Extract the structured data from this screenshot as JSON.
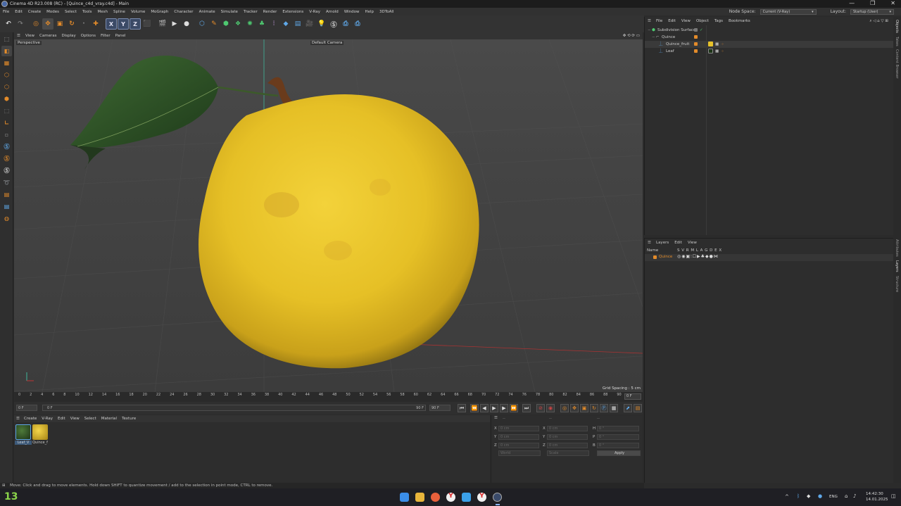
{
  "window": {
    "title": "Cinema 4D R23.008 (RC) - [Quince_c4d_vray.c4d] - Main",
    "controls": [
      "—",
      "❐",
      "✕"
    ]
  },
  "menu": {
    "items": [
      "File",
      "Edit",
      "Create",
      "Modes",
      "Select",
      "Tools",
      "Mesh",
      "Spline",
      "Volume",
      "MoGraph",
      "Character",
      "Animate",
      "Simulate",
      "Tracker",
      "Render",
      "Extensions",
      "V-Ray",
      "Arnold",
      "Window",
      "Help",
      "3DToAll"
    ],
    "node_space_label": "Node Space:",
    "node_space_value": "Current (V-Ray)",
    "layout_label": "Layout:",
    "layout_value": "Startup (User)"
  },
  "viewport": {
    "menu": [
      "View",
      "Cameras",
      "Display",
      "Options",
      "Filter",
      "Panel"
    ],
    "label": "Perspective",
    "camera": "Default Camera",
    "grid_spacing": "Grid Spacing : 5 cm"
  },
  "timeline": {
    "ticks": [
      "0",
      "2",
      "4",
      "6",
      "8",
      "10",
      "12",
      "14",
      "16",
      "18",
      "20",
      "22",
      "24",
      "26",
      "28",
      "30",
      "32",
      "34",
      "36",
      "38",
      "40",
      "42",
      "44",
      "46",
      "48",
      "50",
      "52",
      "54",
      "56",
      "58",
      "60",
      "62",
      "64",
      "66",
      "68",
      "70",
      "72",
      "74",
      "76",
      "78",
      "80",
      "82",
      "84",
      "86",
      "88",
      "90"
    ],
    "current_frame": "0 F",
    "start": "0 F",
    "slider_start": "0 F",
    "slider_end": "90 F",
    "end": "90 F"
  },
  "materials": {
    "menu": [
      "Create",
      "V-Ray",
      "Edit",
      "View",
      "Select",
      "Material",
      "Texture"
    ],
    "items": [
      {
        "label": "Leaf_V",
        "color": "#2a4a22"
      },
      {
        "label": "Quince_f",
        "color": "#d8b92c"
      }
    ]
  },
  "coords": {
    "headers": [
      "--",
      "--",
      "--"
    ],
    "rows": [
      {
        "a": "X",
        "av": "0 cm",
        "b": "X",
        "bv": "0 cm",
        "c": "H",
        "cv": "0 °"
      },
      {
        "a": "Y",
        "av": "0 cm",
        "b": "Y",
        "bv": "0 cm",
        "c": "P",
        "cv": "0 °"
      },
      {
        "a": "Z",
        "av": "0 cm",
        "b": "Z",
        "bv": "0 cm",
        "c": "B",
        "cv": "0 °"
      }
    ],
    "mode1": "World",
    "mode2": "Scale",
    "apply": "Apply"
  },
  "status": "Move: Click and drag to move elements. Hold down SHIFT to quantize movement / add to the selection in point mode, CTRL to remove.",
  "objects": {
    "menu": [
      "File",
      "Edit",
      "View",
      "Object",
      "Tags",
      "Bookmarks"
    ],
    "rows": [
      {
        "name": "Subdivision Surface",
        "indent": 0
      },
      {
        "name": "Quince",
        "indent": 1
      },
      {
        "name": "Quince_fruit",
        "indent": 2
      },
      {
        "name": "Leaf",
        "indent": 2
      }
    ]
  },
  "layers": {
    "menu": [
      "Layers",
      "Edit",
      "View"
    ],
    "header_name": "Name",
    "header_flags": "S V R M L A G D E X",
    "rows": [
      {
        "name": "Quince"
      }
    ]
  },
  "right_tabs": [
    "Objects",
    "Takes",
    "Content Browser",
    "Attributes",
    "Layers",
    "Structure"
  ],
  "taskbar": {
    "badge": "13",
    "lang": "ENG",
    "time": "14:42:30",
    "date": "14.01.2025"
  },
  "colors": {
    "accent_orange": "#e38b2a",
    "selection_blue": "#5fa8e8",
    "quince_yellow": "#e7c22a"
  }
}
